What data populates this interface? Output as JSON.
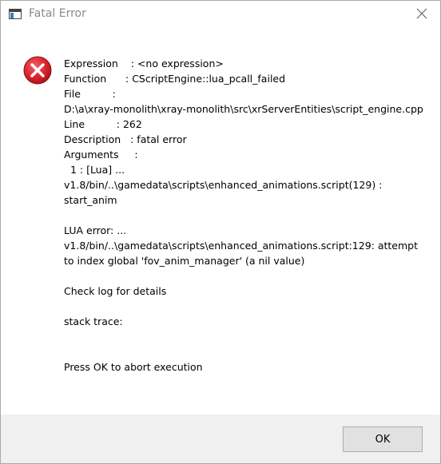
{
  "window": {
    "title": "Fatal Error",
    "icon": "app-window-icon",
    "close_icon": "close-icon"
  },
  "dialog": {
    "icon": "error-icon",
    "message": "Expression    : <no expression>\nFunction      : CScriptEngine::lua_pcall_failed\nFile          :\nD:\\a\\xray-monolith\\xray-monolith\\src\\xrServerEntities\\script_engine.cpp\nLine          : 262\nDescription   : fatal error\nArguments     :\n  1 : [Lua] ...\nv1.8/bin/..\\gamedata\\scripts\\enhanced_animations.script(129) :\nstart_anim\n\nLUA error: ...\nv1.8/bin/..\\gamedata\\scripts\\enhanced_animations.script:129: attempt\nto index global 'fov_anim_manager' (a nil value)\n\nCheck log for details\n\nstack trace:\n\n\nPress OK to abort execution"
  },
  "footer": {
    "ok_label": "OK"
  },
  "colors": {
    "error_red": "#e81123",
    "title_text": "#8a8a8a",
    "footer_bg": "#f0f0f0"
  }
}
